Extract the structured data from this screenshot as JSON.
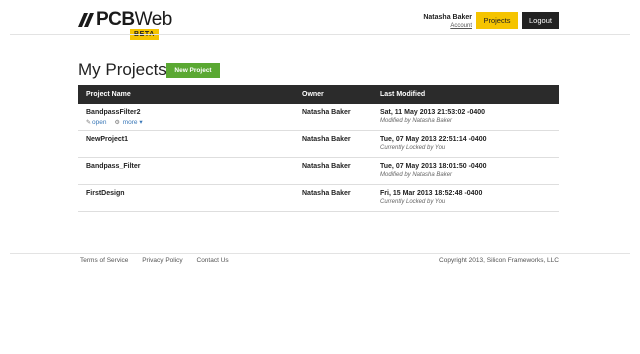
{
  "brand": {
    "name_bold": "PCB",
    "name_rest": "Web",
    "badge": "BETA"
  },
  "header": {
    "user_name": "Natasha Baker",
    "account_link": "Account",
    "projects_button": "Projects",
    "logout_button": "Logout"
  },
  "main": {
    "title": "My Projects",
    "new_project_button": "New Project",
    "columns": [
      "Project Name",
      "Owner",
      "Last Modified"
    ],
    "rows": [
      {
        "name": "BandpassFilter2",
        "owner": "Natasha Baker",
        "modified": "Sat, 11 May 2013 21:53:02 -0400",
        "note": "Modified by Natasha Baker",
        "open_label": "open",
        "more_label": "more"
      },
      {
        "name": "NewProject1",
        "owner": "Natasha Baker",
        "modified": "Tue, 07 May 2013 22:51:14 -0400",
        "note": "Currently Locked by You"
      },
      {
        "name": "Bandpass_Filter",
        "owner": "Natasha Baker",
        "modified": "Tue, 07 May 2013 18:01:50 -0400",
        "note": "Modified by Natasha Baker"
      },
      {
        "name": "FirstDesign",
        "owner": "Natasha Baker",
        "modified": "Fri, 15 Mar 2013 18:52:48 -0400",
        "note": "Currently Locked by You"
      }
    ]
  },
  "footer": {
    "links": [
      "Terms of Service",
      "Privacy Policy",
      "Contact Us"
    ],
    "copyright": "Copyright 2013, Silicon Frameworks, LLC"
  },
  "colors": {
    "accent_yellow": "#f5c400",
    "new_button_green": "#5aa832",
    "header_dark": "#2b2b2b",
    "link_blue": "#3a78b8"
  },
  "icons": {
    "logo": "pcb-logo-icon",
    "open": "open-icon",
    "more": "gear-icon",
    "more_caret": "chevron-down-icon"
  }
}
